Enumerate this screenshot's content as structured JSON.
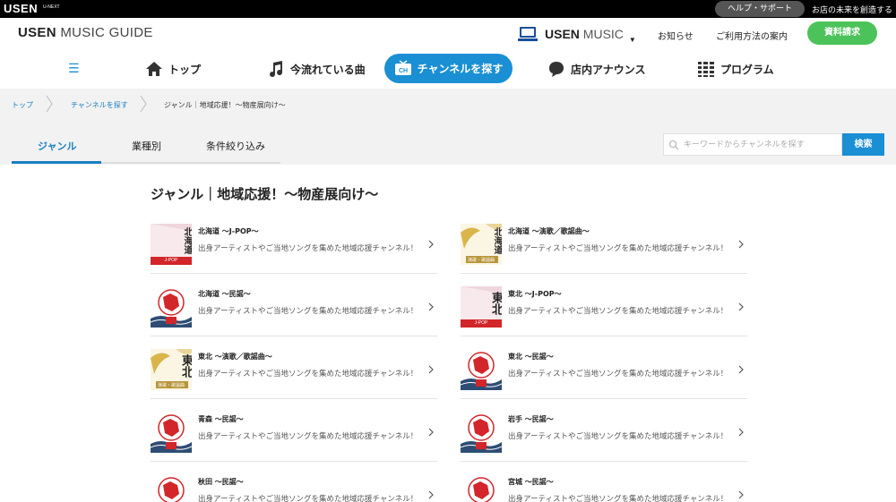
{
  "topbar": {
    "logo": "USEN",
    "sublogo": "U-NEXT",
    "help": "ヘルプ・サポート",
    "tagline": "お店の未来を創造する"
  },
  "header": {
    "site_title_bold": "USEN",
    "site_title_light": " MUSIC GUIDE",
    "service_bold": "USEN",
    "service_light": " MUSIC",
    "news": "お知らせ",
    "guide": "ご利用方法の案内",
    "docs": "資料請求"
  },
  "nav": {
    "menu_glyph": "☰",
    "top": "トップ",
    "now_playing": "今流れている曲",
    "find_channel": "チャンネルを探す",
    "announce": "店内アナウンス",
    "program": "プログラム"
  },
  "breadcrumb": [
    "トップ",
    "チャンネルを探す",
    "ジャンル｜地域応援！〜物産展向け〜"
  ],
  "tabs": [
    "ジャンル",
    "業種別",
    "条件絞り込み"
  ],
  "search": {
    "placeholder": "キーワードからチャンネルを探す",
    "button": "検索"
  },
  "page_title": "ジャンル｜地域応援！〜物産展向け〜",
  "channels": [
    {
      "title": "北海道 〜J-POP〜",
      "desc": "出身アーティストやご当地ソングを集めた地域応援チャンネル！",
      "thumb_kana": "北海道",
      "thumb_tag": "J-POP",
      "style": "red-tag"
    },
    {
      "title": "北海道 〜演歌／歌謡曲〜",
      "desc": "出身アーティストやご当地ソングを集めた地域応援チャンネル！",
      "thumb_kana": "北海道",
      "thumb_tag": "演歌・歌謡曲",
      "style": "gold"
    },
    {
      "title": "北海道 〜民謡〜",
      "desc": "出身アーティストやご当地ソングを集めた地域応援チャンネル！",
      "thumb_kana": "",
      "thumb_tag": "",
      "style": "stamp"
    },
    {
      "title": "東北 〜J-POP〜",
      "desc": "出身アーティストやご当地ソングを集めた地域応援チャンネル！",
      "thumb_kana": "東北",
      "thumb_tag": "J-POP",
      "style": "red-tag"
    },
    {
      "title": "東北 〜演歌／歌謡曲〜",
      "desc": "出身アーティストやご当地ソングを集めた地域応援チャンネル！",
      "thumb_kana": "東北",
      "thumb_tag": "演歌・歌謡曲",
      "style": "gold"
    },
    {
      "title": "東北 〜民謡〜",
      "desc": "出身アーティストやご当地ソングを集めた地域応援チャンネル！",
      "thumb_kana": "",
      "thumb_tag": "",
      "style": "stamp"
    },
    {
      "title": "青森 〜民謡〜",
      "desc": "出身アーティストやご当地ソングを集めた地域応援チャンネル！",
      "thumb_kana": "",
      "thumb_tag": "",
      "style": "stamp"
    },
    {
      "title": "岩手 〜民謡〜",
      "desc": "出身アーティストやご当地ソングを集めた地域応援チャンネル！",
      "thumb_kana": "",
      "thumb_tag": "",
      "style": "stamp"
    },
    {
      "title": "秋田 〜民謡〜",
      "desc": "出身アーティストやご当地ソングを集めた地域応援チャンネル！",
      "thumb_kana": "",
      "thumb_tag": "",
      "style": "stamp"
    },
    {
      "title": "宮城 〜民謡〜",
      "desc": "出身アーティストやご当地ソングを集めた地域応援チャンネル！",
      "thumb_kana": "",
      "thumb_tag": "",
      "style": "stamp"
    }
  ],
  "colors": {
    "accent": "#1a8fd4",
    "green": "#4cc35a",
    "stamp_red": "#d2262a",
    "gold": "#d9b54a"
  }
}
